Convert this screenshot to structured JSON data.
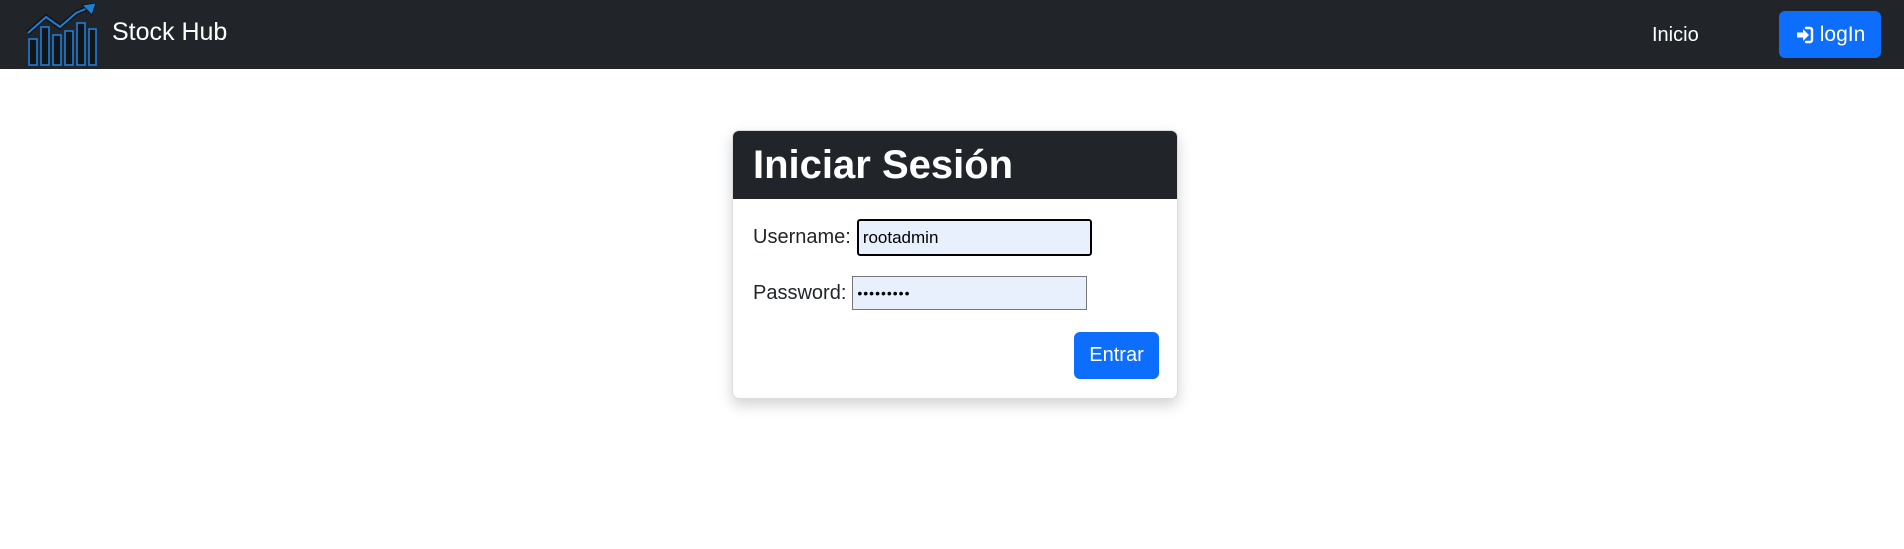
{
  "navbar": {
    "brand_name": "Stock Hub",
    "nav_links": [
      {
        "label": "Inicio"
      }
    ],
    "login_label": "logIn",
    "logo_icon": "rising-chart-logo",
    "login_icon": "sign-in-icon",
    "background": "#212529"
  },
  "login_card": {
    "title": "Iniciar Sesión",
    "username_label": "Username:",
    "username_value": "rootadmin",
    "password_label": "Password:",
    "password_value": "•••••••••",
    "submit_label": "Entrar"
  },
  "colors": {
    "accent": "#0d6efd",
    "dark": "#212529",
    "autofill": "#e8f0fe"
  }
}
